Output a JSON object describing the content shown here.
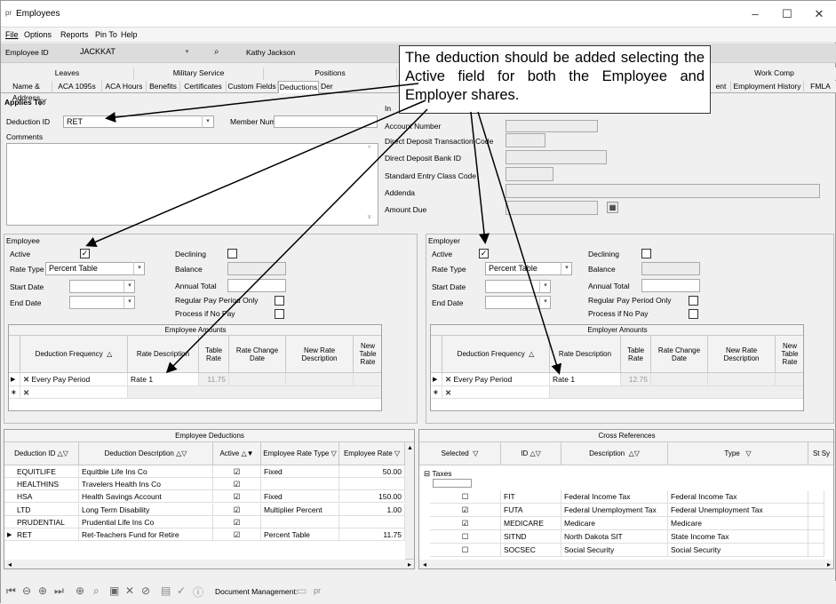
{
  "window": {
    "title": "Employees",
    "logo": "pr",
    "controls": [
      "–",
      "☐",
      "✕"
    ]
  },
  "menu": {
    "file": "File",
    "options": "Options",
    "reports": "Reports",
    "pin_to": "Pin To",
    "help": "Help"
  },
  "toolbar": {
    "employee_id_label": "Employee ID",
    "employee_id_value": "JACKKAT",
    "employee_name": "Kathy Jackson"
  },
  "tabs_row1": [
    "Leaves",
    "Military Service",
    "Positions",
    "Work Comp"
  ],
  "tabs_row2": [
    "Name & Address",
    "ACA 1095s",
    "ACA Hours",
    "Benefits",
    "Certificates",
    "Custom Fields",
    "Deductions",
    "Der",
    "ent",
    "Employment History",
    "FMLA"
  ],
  "callout": {
    "text": "The deduction should be added selecting the Active field for both the Employee and Employer shares."
  },
  "applies_to": {
    "label": "Applies To:",
    "value": "pr"
  },
  "deduction_id": {
    "label": "Deduction ID",
    "value": "RET"
  },
  "member_number": {
    "label": "Member Number",
    "value": ""
  },
  "comments": {
    "label": "Comments"
  },
  "right_fields": [
    {
      "label": "Account Number",
      "value": ""
    },
    {
      "label": "Direct Deposit Transaction Code",
      "value": ""
    },
    {
      "label": "Direct Deposit Bank ID",
      "value": ""
    },
    {
      "label": "Standard Entry Class Code",
      "value": ""
    },
    {
      "label": "Addenda",
      "value": ""
    },
    {
      "label": "Amount Due",
      "value": ""
    }
  ],
  "right_fields_partial_label": "In",
  "employee": {
    "title": "Employee",
    "active_label": "Active",
    "active": true,
    "rate_type_label": "Rate Type",
    "rate_type": "Percent Table",
    "start_date_label": "Start Date",
    "end_date_label": "End Date",
    "declining_label": "Declining",
    "balance_label": "Balance",
    "annual_total_label": "Annual Total",
    "regular_pay_label": "Regular Pay Period Only",
    "no_pay_label": "Process if No Pay",
    "amounts_title": "Employee Amounts",
    "columns": [
      "Deduction Frequency",
      "Rate Description",
      "Table Rate",
      "Rate Change Date",
      "New Rate Description",
      "New Table Rate"
    ],
    "row": {
      "frequency": "Every Pay Period",
      "rate_desc": "Rate 1",
      "table_rate": "11.75"
    }
  },
  "employer": {
    "title": "Employer",
    "active_label": "Active",
    "active": true,
    "rate_type_label": "Rate Type",
    "rate_type": "Percent Table",
    "start_date_label": "Start Date",
    "end_date_label": "End Date",
    "declining_label": "Declining",
    "balance_label": "Balance",
    "annual_total_label": "Annual Total",
    "regular_pay_label": "Regular Pay Period Only",
    "no_pay_label": "Process if No Pay",
    "amounts_title": "Employer Amounts",
    "columns": [
      "Deduction Frequency",
      "Rate Description",
      "Table Rate",
      "Rate Change Date",
      "New Rate Description",
      "New Table Rate"
    ],
    "row": {
      "frequency": "Every Pay Period",
      "rate_desc": "Rate 1",
      "table_rate": "12.75"
    }
  },
  "emp_deductions": {
    "title": "Employee Deductions",
    "columns": [
      "Deduction ID",
      "Deduction Description",
      "Active",
      "Employee Rate Type",
      "Employee Rate"
    ],
    "rows": [
      {
        "id": "EQUITLIFE",
        "desc": "Equitble Life Ins Co",
        "active": true,
        "type": "Fixed",
        "rate": "50.00"
      },
      {
        "id": "HEALTHINS",
        "desc": "Travelers Health Ins Co",
        "active": true,
        "type": "",
        "rate": ""
      },
      {
        "id": "HSA",
        "desc": "Health Savings Account",
        "active": true,
        "type": "Fixed",
        "rate": "150.00"
      },
      {
        "id": "LTD",
        "desc": "Long Term Disability",
        "active": true,
        "type": "Multiplier Percent",
        "rate": "1.00"
      },
      {
        "id": "PRUDENTIAL",
        "desc": "Prudential Life Ins Co",
        "active": true,
        "type": "",
        "rate": ""
      },
      {
        "id": "RET",
        "desc": "Ret-Teachers Fund for Retire",
        "active": true,
        "type": "Percent Table",
        "rate": "11.75"
      }
    ]
  },
  "cross_refs": {
    "title": "Cross References",
    "columns": [
      "Selected",
      "ID",
      "Description",
      "Type",
      "St Sy"
    ],
    "group": "Taxes",
    "rows": [
      {
        "selected": false,
        "id": "FIT",
        "desc": "Federal Income Tax",
        "type": "Federal Income Tax"
      },
      {
        "selected": true,
        "id": "FUTA",
        "desc": "Federal Unemployment Tax",
        "type": "Federal Unemployment Tax"
      },
      {
        "selected": true,
        "id": "MEDICARE",
        "desc": "Medicare",
        "type": "Medicare"
      },
      {
        "selected": false,
        "id": "SITND",
        "desc": "North Dakota SIT",
        "type": "State Income Tax"
      },
      {
        "selected": false,
        "id": "SOCSEC",
        "desc": "Social Security",
        "type": "Social Security"
      }
    ]
  },
  "statusbar": {
    "doc_mgmt": "Document Management:"
  }
}
